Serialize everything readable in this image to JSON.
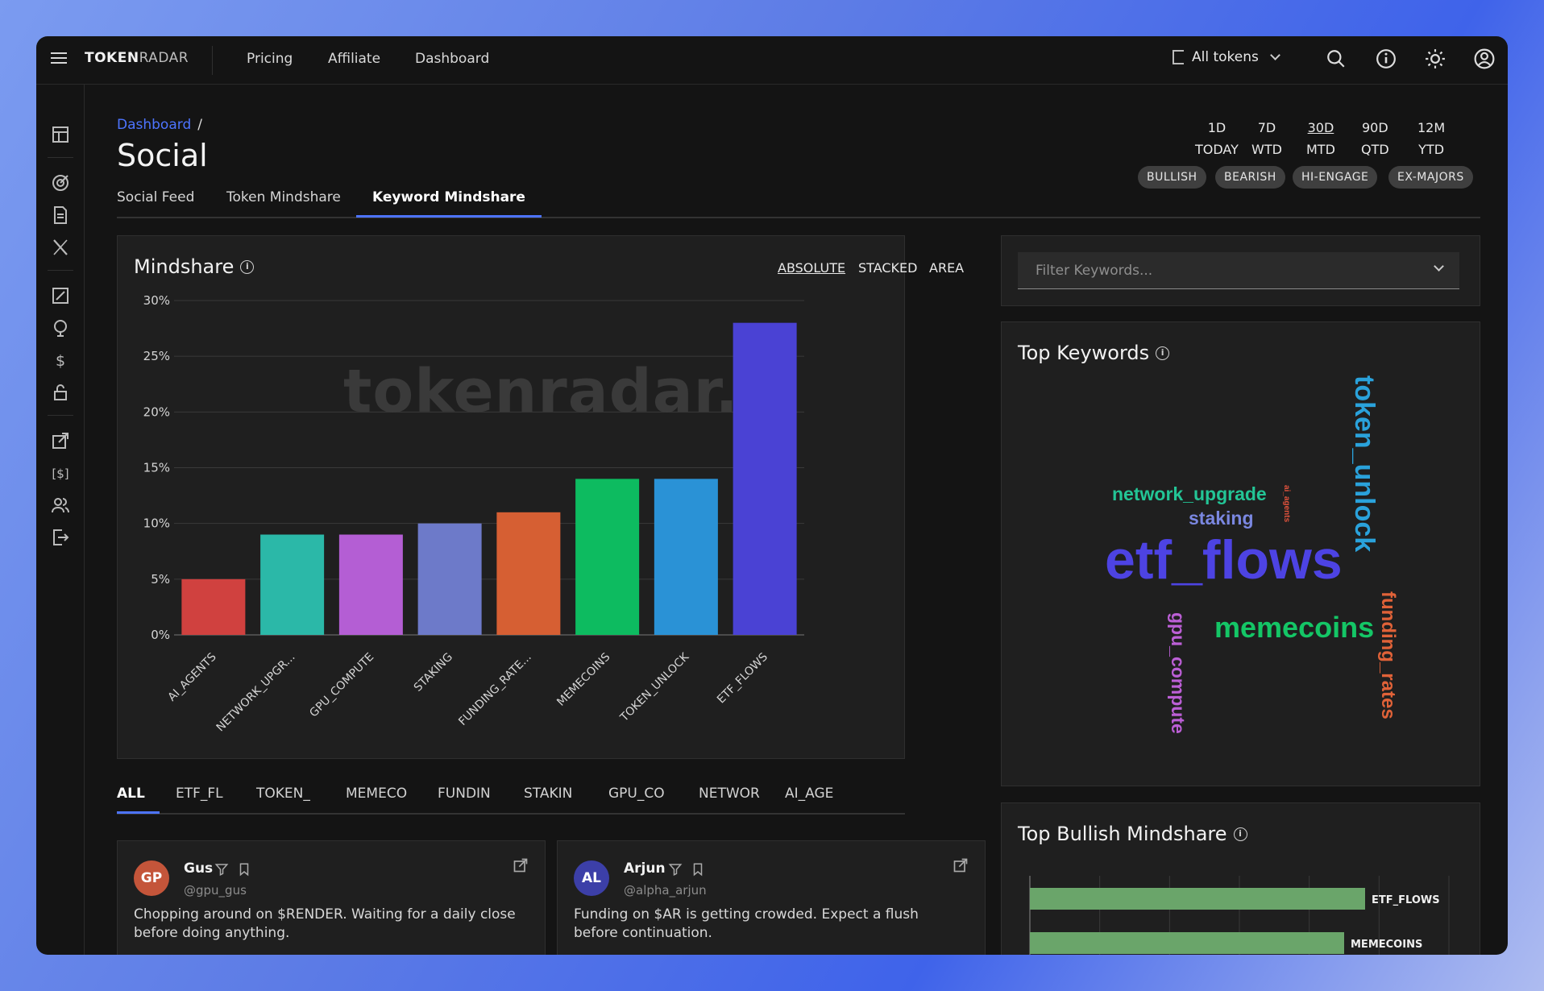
{
  "app": {
    "logo_bold": "TOKEN",
    "logo_light": "RADAR"
  },
  "nav": [
    "Pricing",
    "Affiliate",
    "Dashboard"
  ],
  "token_select": {
    "label": "All tokens"
  },
  "breadcrumb": {
    "root": "Dashboard",
    "sep": "/"
  },
  "page_title": "Social",
  "tabs": [
    "Social Feed",
    "Token Mindshare",
    "Keyword Mindshare"
  ],
  "periods": [
    {
      "top": "1D",
      "bottom": "TODAY"
    },
    {
      "top": "7D",
      "bottom": "WTD"
    },
    {
      "top": "30D",
      "bottom": "MTD"
    },
    {
      "top": "90D",
      "bottom": "QTD"
    },
    {
      "top": "12M",
      "bottom": "YTD"
    }
  ],
  "filters": [
    "BULLISH",
    "BEARISH",
    "HI-ENGAGE",
    "EX-MAJORS"
  ],
  "mindshare": {
    "title": "Mindshare",
    "modes": [
      "ABSOLUTE",
      "STACKED",
      "AREA"
    ],
    "watermark": "tokenradar.ai"
  },
  "chart_data": {
    "type": "bar",
    "categories": [
      "AI_AGENTS",
      "NETWORK_UPGR...",
      "GPU_COMPUTE",
      "STAKING",
      "FUNDING_RATE...",
      "MEMECOINS",
      "TOKEN_UNLOCK",
      "ETF_FLOWS"
    ],
    "values": [
      5,
      9,
      9,
      10,
      11,
      14,
      14,
      28
    ],
    "colors": [
      "#d0413f",
      "#2bb8a8",
      "#b45ed4",
      "#6d7ac9",
      "#d65f33",
      "#0dbb60",
      "#2a92d6",
      "#4a42d4"
    ],
    "yticks": [
      "0%",
      "5%",
      "10%",
      "15%",
      "20%",
      "25%",
      "30%"
    ],
    "ylim": [
      0,
      30
    ]
  },
  "keyword_filter": {
    "placeholder": "Filter Keywords..."
  },
  "top_keywords": {
    "title": "Top Keywords",
    "words": {
      "token_unlock": "token_unlock",
      "network_upgrade": "network_upgrade",
      "ai_agents": "ai_agents",
      "staking": "staking",
      "etf_flows": "etf_flows",
      "funding_rates": "funding_rates",
      "gpu_compute": "gpu_compute",
      "memecoins": "memecoins"
    }
  },
  "bullish": {
    "title": "Top Bullish Mindshare",
    "bars": [
      {
        "label": "ETF_FLOWS",
        "value": 0.8
      },
      {
        "label": "MEMECOINS",
        "value": 0.75
      }
    ]
  },
  "keyword_tabs": [
    "ALL",
    "ETF_FL",
    "TOKEN_",
    "MEMECO",
    "FUNDIN",
    "STAKIN",
    "GPU_CO",
    "NETWOR",
    "AI_AGE"
  ],
  "posts": [
    {
      "initials": "GP",
      "name": "Gus",
      "handle": "@gpu_gus",
      "text": "Chopping around on $RENDER. Waiting for a daily close before doing anything.",
      "color": "#c4553a"
    },
    {
      "initials": "AL",
      "name": "Arjun",
      "handle": "@alpha_arjun",
      "text": "Funding on $AR is getting crowded. Expect a flush before continuation.",
      "color": "#3c3fa8"
    }
  ]
}
